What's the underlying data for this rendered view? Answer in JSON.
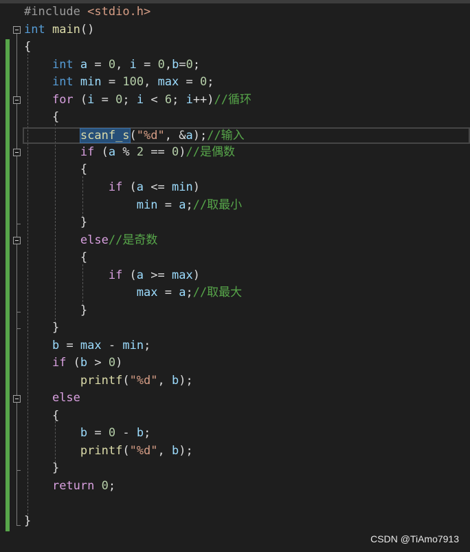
{
  "editor": {
    "code": {
      "include": "#include",
      "header": "<stdio.h>",
      "main_type": "int",
      "main_name": "main",
      "main_parens": "()",
      "open_brace": "{",
      "close_brace": "}",
      "decl1_type": "int",
      "decl1_a": "a",
      "decl1_rest1": " = ",
      "decl1_zero1": "0",
      "decl1_comma1": ", ",
      "decl1_i": "i",
      "decl1_zero2": "0",
      "decl1_b": "b",
      "decl1_zero3": "0",
      "decl2_type": "int",
      "decl2_min": "min",
      "decl2_100": "100",
      "decl2_max": "max",
      "decl2_zero": "0",
      "for_kw": "for",
      "for_i1": "i",
      "for_0": "0",
      "for_i2": "i",
      "for_6": "6",
      "for_i3": "i",
      "for_comment": "//循环",
      "scanf_fn": "scanf_s",
      "scanf_str": "\"%d\"",
      "scanf_a": "a",
      "scanf_comment": "//输入",
      "if1_kw": "if",
      "if1_a": "a",
      "if1_2": "2",
      "if1_0": "0",
      "if1_comment": "//是偶数",
      "if2_kw": "if",
      "if2_a": "a",
      "if2_min": "min",
      "assign1_min": "min",
      "assign1_a": "a",
      "assign1_comment": "//取最小",
      "else1_kw": "else",
      "else1_comment": "//是奇数",
      "if3_kw": "if",
      "if3_a": "a",
      "if3_max": "max",
      "assign2_max": "max",
      "assign2_a": "a",
      "assign2_comment": "//取最大",
      "bcalc_b": "b",
      "bcalc_max": "max",
      "bcalc_min": "min",
      "if4_kw": "if",
      "if4_b": "b",
      "if4_0": "0",
      "printf1_fn": "printf",
      "printf1_str": "\"%d\"",
      "printf1_b": "b",
      "else2_kw": "else",
      "b2_b1": "b",
      "b2_0": "0",
      "b2_b2": "b",
      "printf2_fn": "printf",
      "printf2_str": "\"%d\"",
      "printf2_b": "b",
      "return_kw": "return",
      "return_0": "0"
    }
  },
  "watermark": "CSDN @TiAmo7913"
}
